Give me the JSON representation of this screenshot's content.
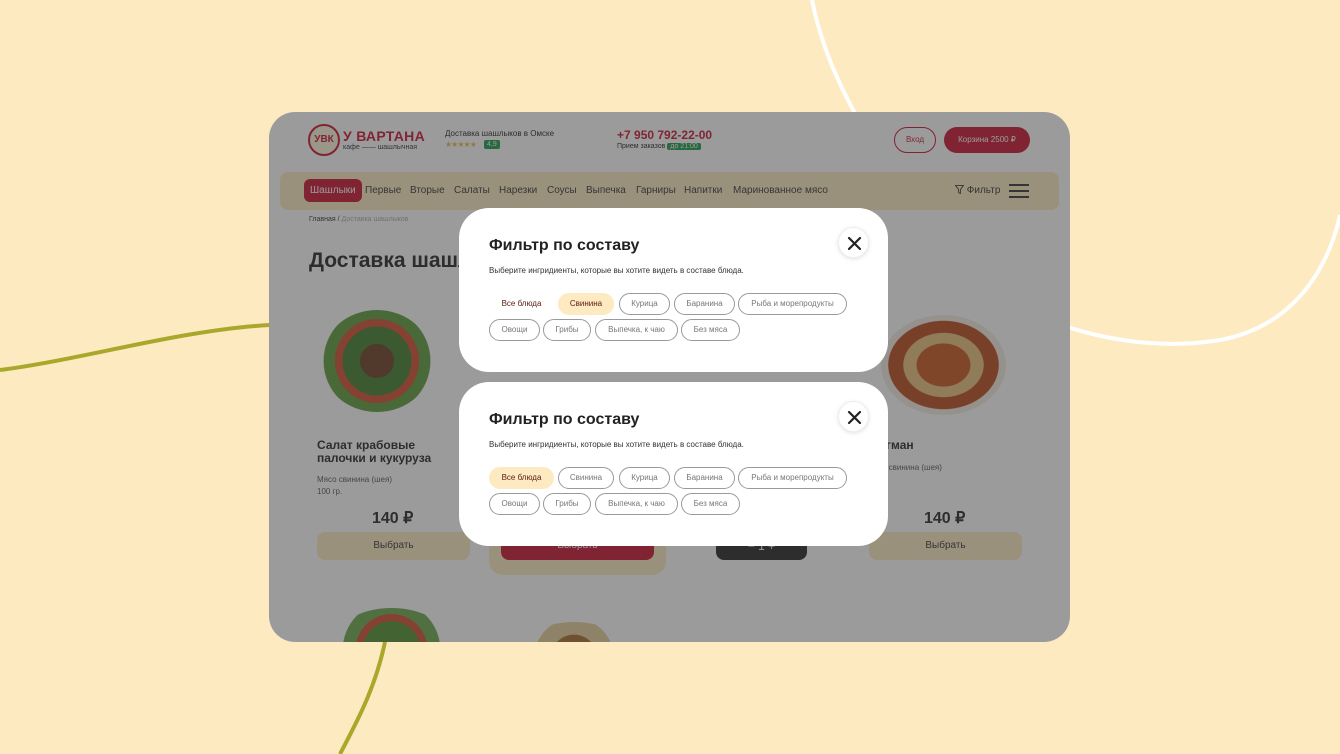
{
  "header": {
    "logo_text": "УВК",
    "brand": "У ВАРТАНА",
    "brand_sub": "кафе —— шашлычная",
    "delivery_text": "Доставка шашлыков в Омске",
    "stars": "★★★★★",
    "rating": "4,9",
    "phone": "+7 950 792-22-00",
    "hours_label": "Прием заказов",
    "hours_badge": "до 21:00",
    "login_label": "Вход",
    "cart_label": "Корзина   2500 ₽"
  },
  "nav": {
    "items": [
      {
        "label": "Шашлыки",
        "active": true
      },
      {
        "label": "Первые"
      },
      {
        "label": "Вторые"
      },
      {
        "label": "Салаты"
      },
      {
        "label": "Нарезки"
      },
      {
        "label": "Соусы"
      },
      {
        "label": "Выпечка"
      },
      {
        "label": "Гарниры"
      },
      {
        "label": "Напитки"
      },
      {
        "label": "Маринованное мясо"
      }
    ],
    "filter_label": "Фильтр"
  },
  "breadcrumb": {
    "home": "Главная",
    "separator": "/",
    "current": "Доставка шашлыков"
  },
  "page_title": "Доставка шашлыков",
  "cards": [
    {
      "title": "Салат крабовые палочки и кукуруза",
      "meta1": "Мясо свинина (шея)",
      "meta2": "100 гр.",
      "price": "140 ₽",
      "button": "Выбрать"
    },
    {
      "button": "Выбрать"
    },
    {
      "stepper": "−   1   +"
    },
    {
      "title": "…гман",
      "meta1": "…о свинина (шея)",
      "meta2": "…р.",
      "price": "140 ₽",
      "button": "Выбрать"
    }
  ],
  "modals": [
    {
      "title": "Фильтр по составу",
      "description": "Выберите ингридиенты, которые вы хотите видеть в составе блюда.",
      "selected": "Свинина",
      "chips": [
        "Все блюда",
        "Свинина",
        "Курица",
        "Баранина",
        "Рыба и морепродукты",
        "Овощи",
        "Грибы",
        "Выпечка, к чаю",
        "Без мяса"
      ]
    },
    {
      "title": "Фильтр по составу",
      "description": "Выберите ингридиенты, которые вы хотите видеть в составе блюда.",
      "selected": "Все блюда",
      "chips": [
        "Все блюда",
        "Свинина",
        "Курица",
        "Баранина",
        "Рыба и морепродукты",
        "Овощи",
        "Грибы",
        "Выпечка, к чаю",
        "Без мяса"
      ]
    }
  ],
  "colors": {
    "background": "#fdeac0",
    "accent": "#c8102e",
    "chip_active": "#fdeac0",
    "rating_green": "#1b9b4b",
    "curve_olive": "#a9a82a",
    "curve_white": "#ffffff"
  },
  "icons": {
    "close": "close-icon",
    "filter": "filter-icon",
    "menu": "burger-menu-icon"
  }
}
